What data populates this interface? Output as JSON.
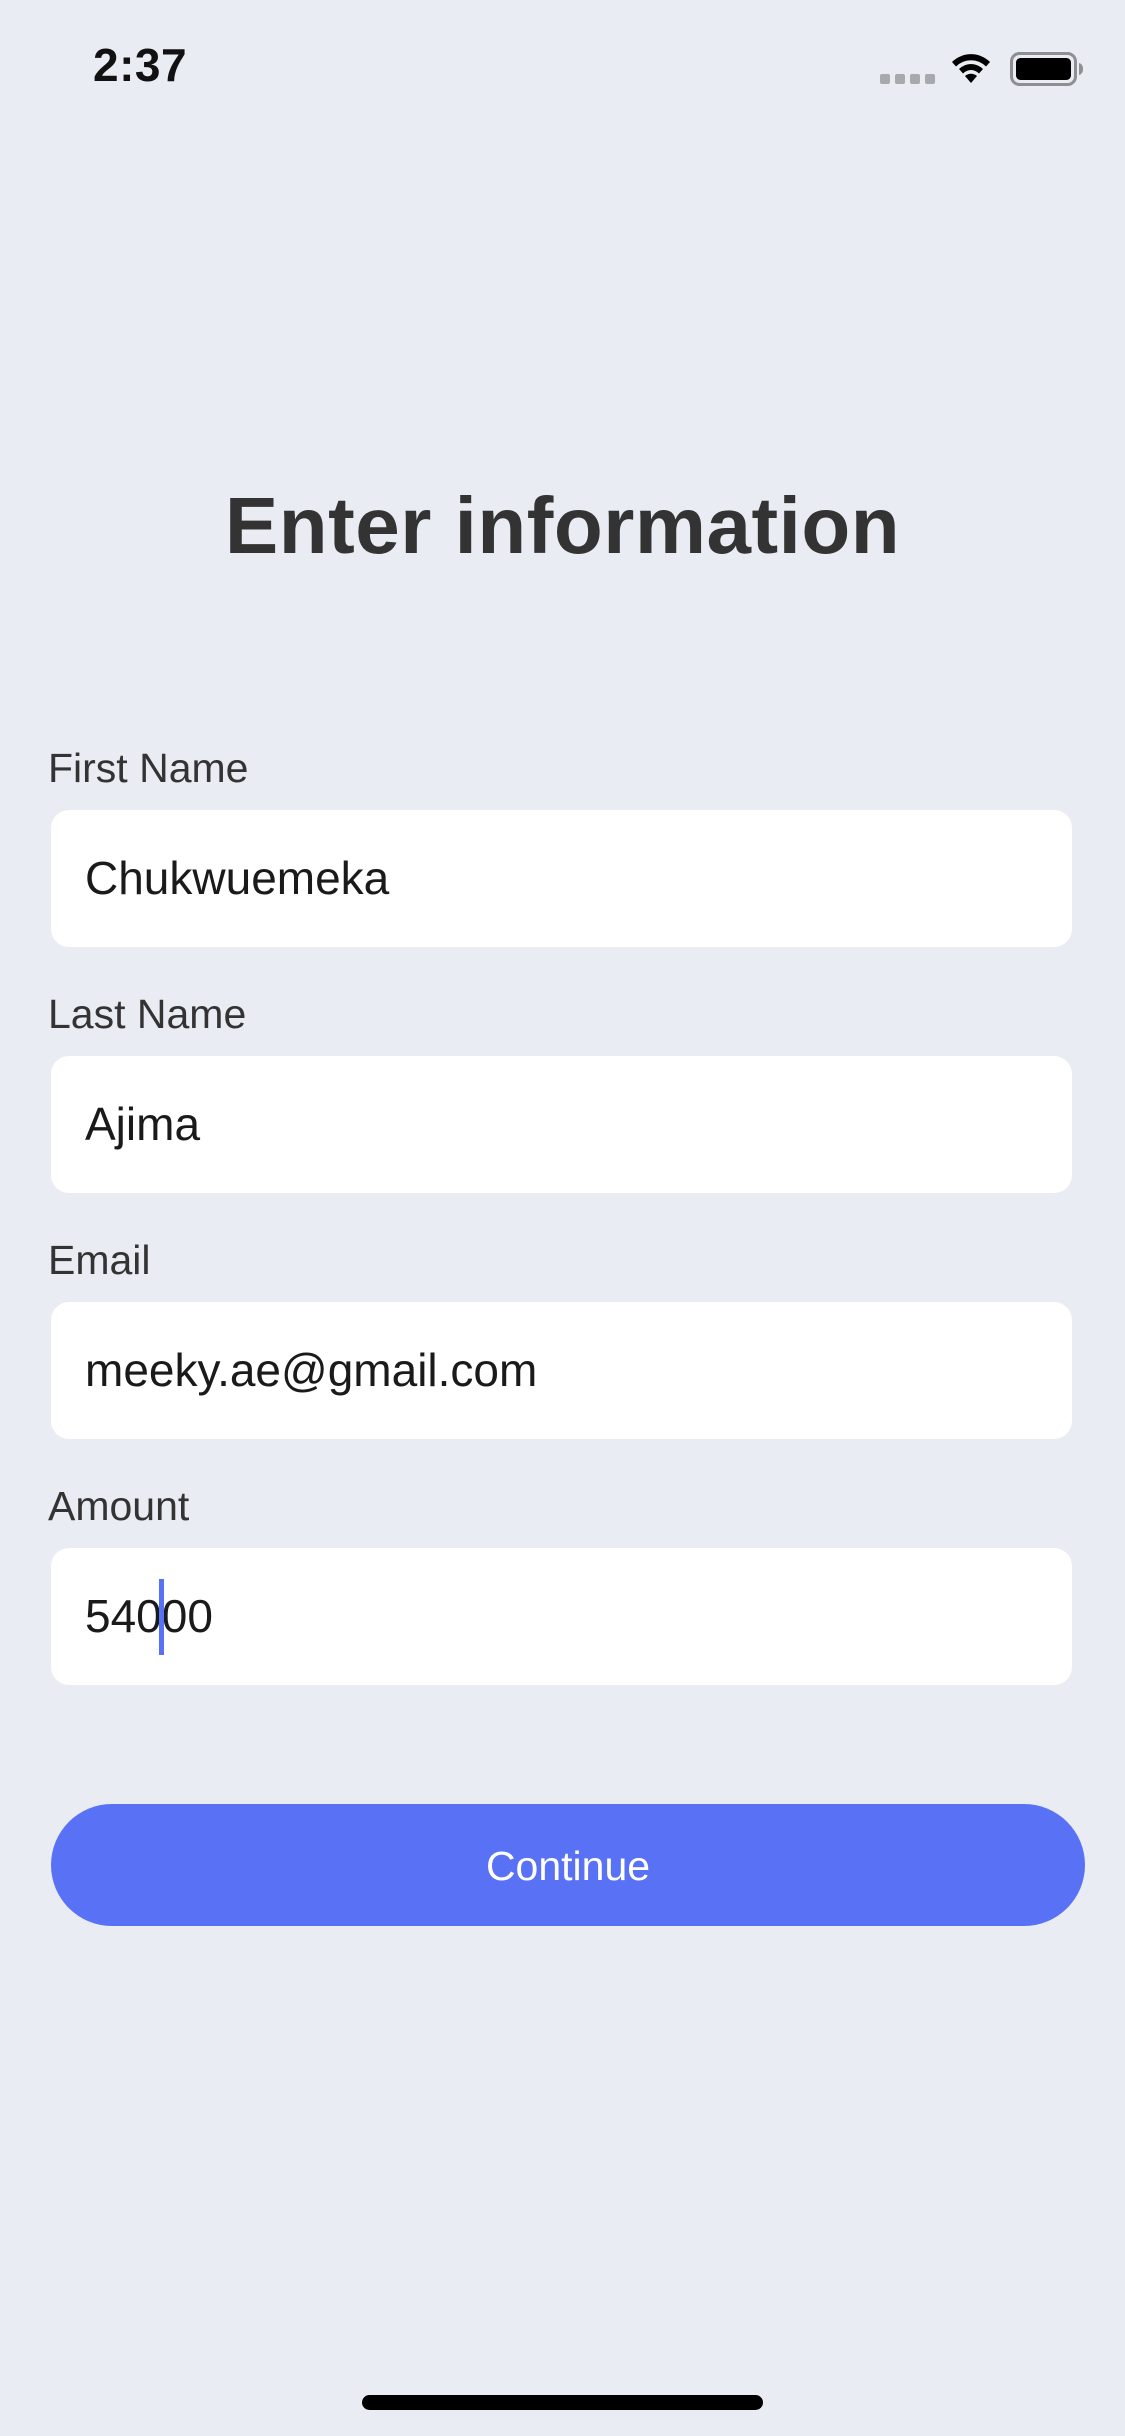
{
  "status_bar": {
    "time": "2:37",
    "icons": [
      "signal-icon",
      "wifi-icon",
      "battery-icon"
    ]
  },
  "title": "Enter information",
  "form": {
    "first_name": {
      "label": "First Name",
      "value": "Chukwuemeka"
    },
    "last_name": {
      "label": "Last Name",
      "value": "Ajima"
    },
    "email": {
      "label": "Email",
      "value": "meeky.ae@gmail.com"
    },
    "amount": {
      "label": "Amount",
      "value_before_cursor": "540",
      "value_after_cursor": "00"
    }
  },
  "continue_button": {
    "label": "Continue"
  },
  "colors": {
    "background": "#e9ecf2",
    "accent": "#5871f5",
    "text": "#333333",
    "field": "#ffffff"
  }
}
